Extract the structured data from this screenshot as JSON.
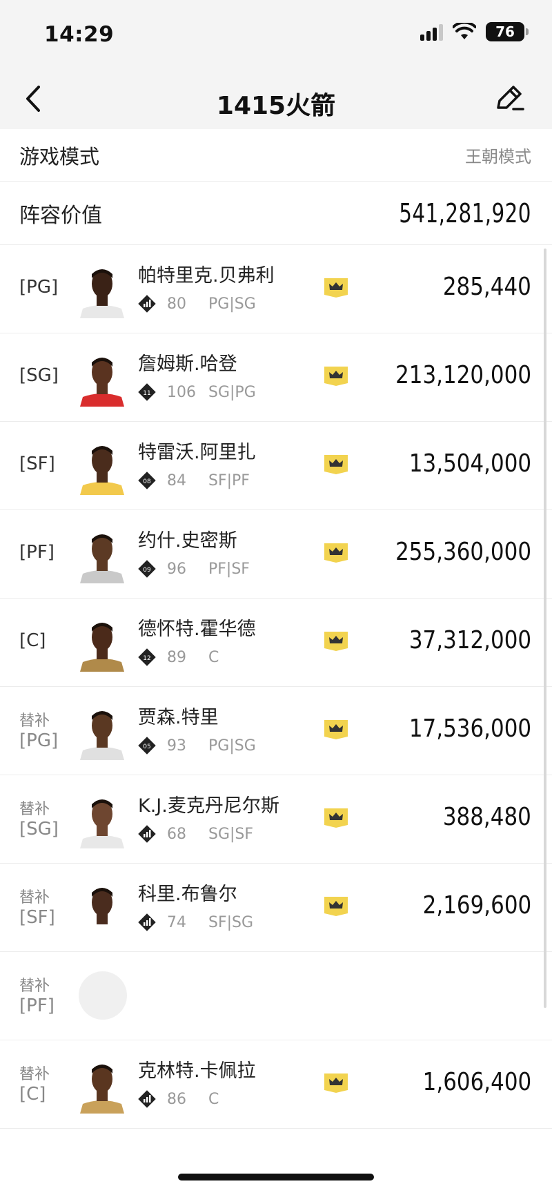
{
  "status": {
    "time": "14:29",
    "battery": "76"
  },
  "header": {
    "title": "1415火箭"
  },
  "mode": {
    "label": "游戏模式",
    "value": "王朝模式"
  },
  "lineup": {
    "label": "阵容价值",
    "value": "541,281,920"
  },
  "players": [
    {
      "slot": "[PG]",
      "sub": "",
      "name": "帕特里克.贝弗利",
      "badge": "bars",
      "ovr": "80",
      "positions": "PG|SG",
      "price": "285,440"
    },
    {
      "slot": "[SG]",
      "sub": "",
      "name": "詹姆斯.哈登",
      "badge": "11",
      "ovr": "106",
      "positions": "SG|PG",
      "price": "213,120,000"
    },
    {
      "slot": "[SF]",
      "sub": "",
      "name": "特雷沃.阿里扎",
      "badge": "08",
      "ovr": "84",
      "positions": "SF|PF",
      "price": "13,504,000"
    },
    {
      "slot": "[PF]",
      "sub": "",
      "name": "约什.史密斯",
      "badge": "09",
      "ovr": "96",
      "positions": "PF|SF",
      "price": "255,360,000"
    },
    {
      "slot": "[C]",
      "sub": "",
      "name": "德怀特.霍华德",
      "badge": "12",
      "ovr": "89",
      "positions": "C",
      "price": "37,312,000"
    },
    {
      "slot": "[PG]",
      "sub": "替补",
      "name": "贾森.特里",
      "badge": "05",
      "ovr": "93",
      "positions": "PG|SG",
      "price": "17,536,000"
    },
    {
      "slot": "[SG]",
      "sub": "替补",
      "name": "K.J.麦克丹尼尔斯",
      "badge": "bars",
      "ovr": "68",
      "positions": "SG|SF",
      "price": "388,480"
    },
    {
      "slot": "[SF]",
      "sub": "替补",
      "name": "科里.布鲁尔",
      "badge": "bars",
      "ovr": "74",
      "positions": "SF|SG",
      "price": "2,169,600"
    },
    {
      "slot": "[PF]",
      "sub": "替补",
      "name": "",
      "badge": "",
      "ovr": "",
      "positions": "",
      "price": "",
      "empty": true
    },
    {
      "slot": "[C]",
      "sub": "替补",
      "name": "克林特.卡佩拉",
      "badge": "bars",
      "ovr": "86",
      "positions": "C",
      "price": "1,606,400"
    }
  ],
  "colors": {
    "crown": "#f2d34f",
    "accent": "#111111",
    "muted": "#999999"
  }
}
